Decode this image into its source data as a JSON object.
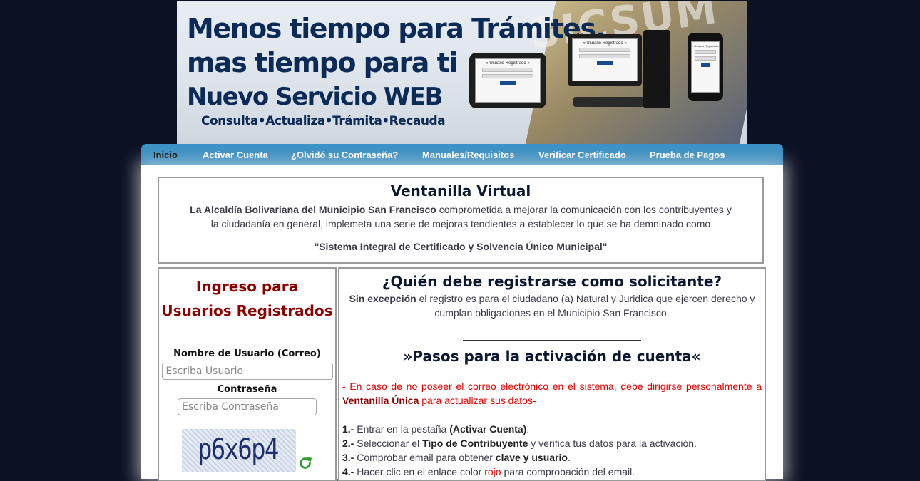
{
  "banner": {
    "line1": "Menos tiempo para Trámites,",
    "line2": "mas tiempo para ti",
    "line3": "Nuevo Servicio WEB",
    "line4": "Consulta•Actualiza•Trámita•Recauda",
    "logo_text": "SICSUM",
    "screen_label": "» Usuario Registrado «"
  },
  "nav": {
    "items": [
      {
        "label": "Inicio"
      },
      {
        "label": "Activar Cuenta"
      },
      {
        "label": "¿Olvidó su Contraseña?"
      },
      {
        "label": "Manuales/Requisitos"
      },
      {
        "label": "Verificar Certificado"
      },
      {
        "label": "Prueba de Pagos"
      }
    ],
    "active_index": 0
  },
  "intro": {
    "title": "Ventanilla Virtual",
    "org": "La Alcaldía Bolivariana del Municipio San Francisco",
    "text": " comprometida a mejorar la comunicación con los contribuyentes y la ciudadanía en general, implemeta una serie de mejoras tendientes a establecer lo que se ha demninado como",
    "quote": "\"Sistema Integral de Certificado y Solvencia Único Municipal\""
  },
  "login": {
    "title_line1": "Ingreso para",
    "title_line2": "Usuarios Registrados",
    "username_label": "Nombre de Usuario (Correo)",
    "username_placeholder": "Escriba Usuario",
    "password_label": "Contraseña",
    "password_placeholder": "Escriba Contraseña",
    "captcha_text": "p6x6p4"
  },
  "info": {
    "title": "¿Quién debe registrarse como solicitante?",
    "desc_bold": "Sin excepción",
    "desc": " el registro es para el ciudadano (a) Natural y Juridica que ejercen derecho y cumplan obligaciones en el Municipio San Francisco.",
    "steps_title": "»Pasos para la activación de cuenta«",
    "notice_pre": "- En caso de no poseer el correo electrónico en el sistema, debe dirigirse personalmente a ",
    "notice_bold": "Ventanilla Única",
    "notice_post": " para actualizar sus datos-",
    "steps": [
      {
        "num": "1.-",
        "pre": " Entrar en la pestaña ",
        "bold": "(Activar Cuenta)",
        "post": "."
      },
      {
        "num": "2.-",
        "pre": " Seleccionar el ",
        "bold": "Tipo de Contribuyente",
        "post": " y verifica tus datos para la activación."
      },
      {
        "num": "3.-",
        "pre": " Comprobar email para obtener ",
        "bold": "clave y usuario",
        "post": "."
      },
      {
        "num": "4.-",
        "pre": " Hacer clic en el enlace color ",
        "red": "rojo",
        "post": " para comprobación del email."
      }
    ]
  },
  "colors": {
    "page_bg": "#0b1224",
    "nav_bg": "#2d7fb4",
    "login_title": "#8b0000",
    "notice": "#e00000"
  }
}
